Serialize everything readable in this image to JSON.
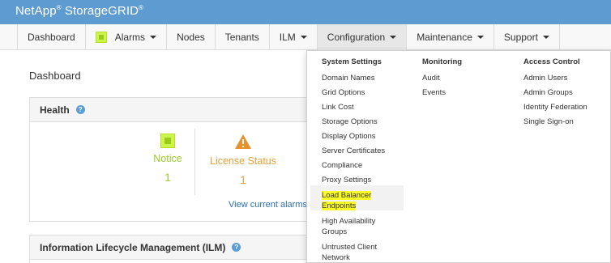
{
  "brand": {
    "name": "NetApp",
    "sup1": "®",
    "product": " StorageGRID",
    "sup2": "®"
  },
  "nav": {
    "items": [
      {
        "label": "Dashboard"
      },
      {
        "label": "Alarms"
      },
      {
        "label": "Nodes"
      },
      {
        "label": "Tenants"
      },
      {
        "label": "ILM"
      },
      {
        "label": "Configuration"
      },
      {
        "label": "Maintenance"
      },
      {
        "label": "Support"
      }
    ]
  },
  "page": {
    "title": "Dashboard"
  },
  "health": {
    "heading": "Health",
    "notice": {
      "label": "Notice",
      "count": "1"
    },
    "license": {
      "label": "License Status",
      "count": "1"
    },
    "link": "View current alarms"
  },
  "ilm": {
    "heading": "Information Lifecycle Management (ILM)"
  },
  "menu": {
    "system": {
      "heading": "System Settings",
      "items": [
        "Domain Names",
        "Grid Options",
        "Link Cost",
        "Storage Options",
        "Display Options",
        "Server Certificates",
        "Compliance",
        "Proxy Settings"
      ],
      "lb1": "Load Balancer",
      "lb2": "Endpoints",
      "ha1": "High Availability",
      "ha2": "Groups",
      "uc1": "Untrusted Client",
      "uc2": "Network"
    },
    "monitoring": {
      "heading": "Monitoring",
      "items": [
        "Audit",
        "Events"
      ]
    },
    "access": {
      "heading": "Access Control",
      "items": [
        "Admin Users",
        "Admin Groups",
        "Identity Federation",
        "Single Sign-on"
      ]
    }
  },
  "colors": {
    "brand_bar": "#5e9bd1",
    "highlight": "#fbfb27",
    "notice": "#9bcb2e",
    "warning": "#e8a13b"
  }
}
